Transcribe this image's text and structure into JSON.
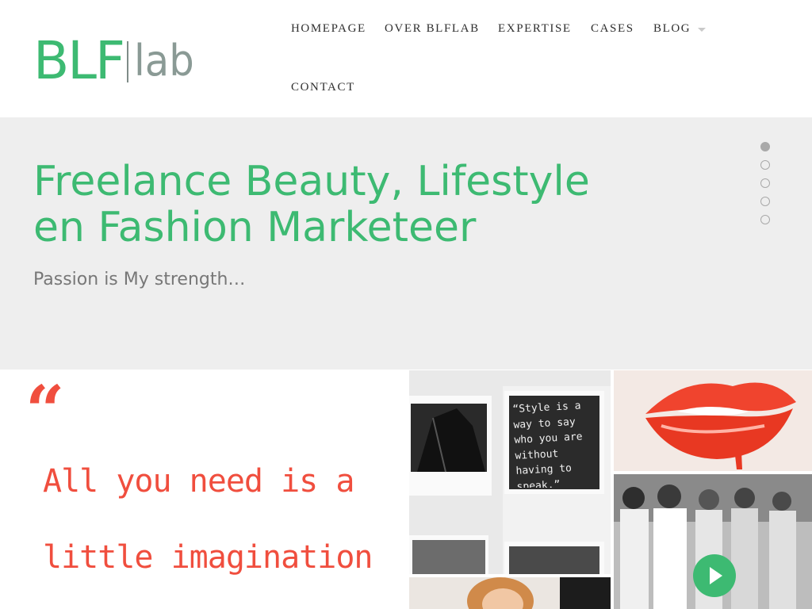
{
  "header": {
    "logo": {
      "bold": "BLF",
      "light": "lab"
    },
    "nav": [
      {
        "label": "HOMEPAGE"
      },
      {
        "label": "OVER BLFLAB"
      },
      {
        "label": "EXPERTISE"
      },
      {
        "label": "CASES"
      },
      {
        "label": "BLOG",
        "has_dropdown": true
      },
      {
        "label": "CONTACT"
      }
    ]
  },
  "hero": {
    "title_line1": "Freelance Beauty, Lifestyle",
    "title_line2": "en Fashion Marketeer",
    "subtitle": "Passion is My strength…",
    "slider_dots": {
      "count": 5,
      "active_index": 0
    }
  },
  "quote": {
    "mark": "“",
    "line1": "All you need is a",
    "line2": "little imagination"
  },
  "gallery": {
    "poster_quote": "“Style is a way to say who you are without having to speak.”"
  },
  "colors": {
    "brand_green": "#3dba72",
    "quote_red": "#f04e3e",
    "hero_bg": "#eeeeee"
  }
}
